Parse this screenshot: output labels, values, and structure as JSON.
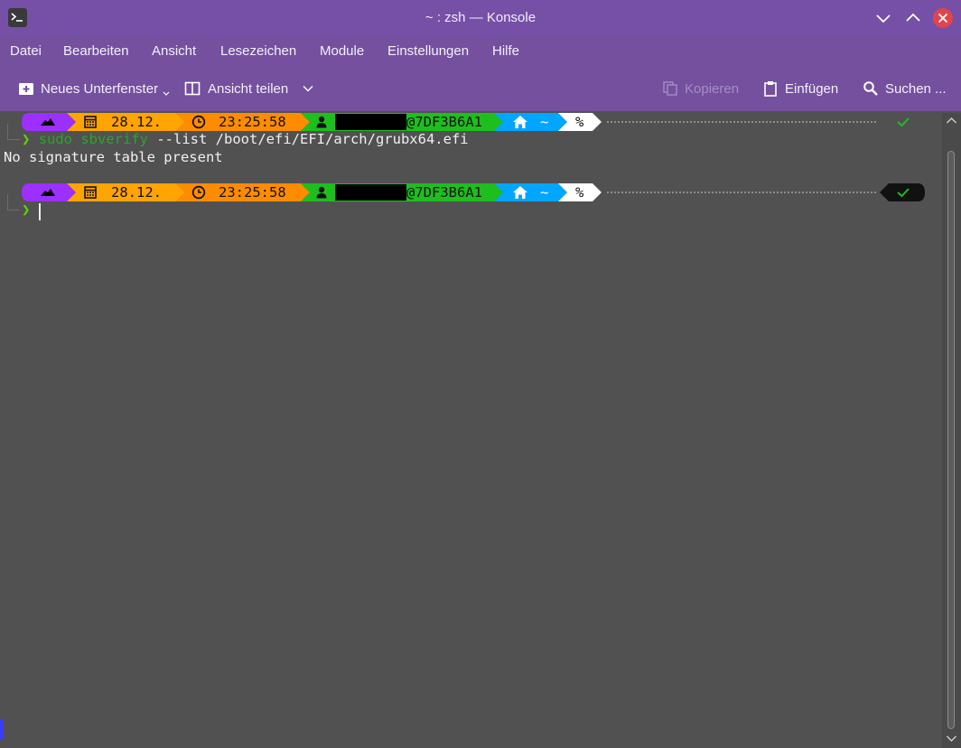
{
  "window": {
    "title": "~ : zsh — Konsole"
  },
  "menubar": {
    "items": [
      "Datei",
      "Bearbeiten",
      "Ansicht",
      "Lesezeichen",
      "Module",
      "Einstellungen",
      "Hilfe"
    ]
  },
  "toolbar": {
    "new_tab_label": "Neues Unterfenster",
    "split_view_label": "Ansicht teilen",
    "copy_label": "Kopieren",
    "paste_label": "Einfügen",
    "search_label": "Suchen ..."
  },
  "prompt": {
    "date": "28.12.",
    "time": "23:25:58",
    "host": "@7DF3B6A1",
    "dir": "~",
    "symbol": "%",
    "status_icon": "check-icon",
    "arrow": "❯"
  },
  "terminal": {
    "command_sudo": "sudo sbverify",
    "command_args": " --list /boot/efi/EFI/arch/grubx64.efi",
    "output_line": "No signature table present"
  },
  "colors": {
    "titlebar": "#7650a6",
    "terminal_bg": "#515151",
    "seg_os": "#9b30ff",
    "seg_date": "#ffa400",
    "seg_time": "#ff8c00",
    "seg_user": "#1fbe1f",
    "seg_dir": "#00a6ff",
    "seg_git": "#ffffff",
    "prompt_green": "#5fd700",
    "close_button": "#e0454e"
  }
}
